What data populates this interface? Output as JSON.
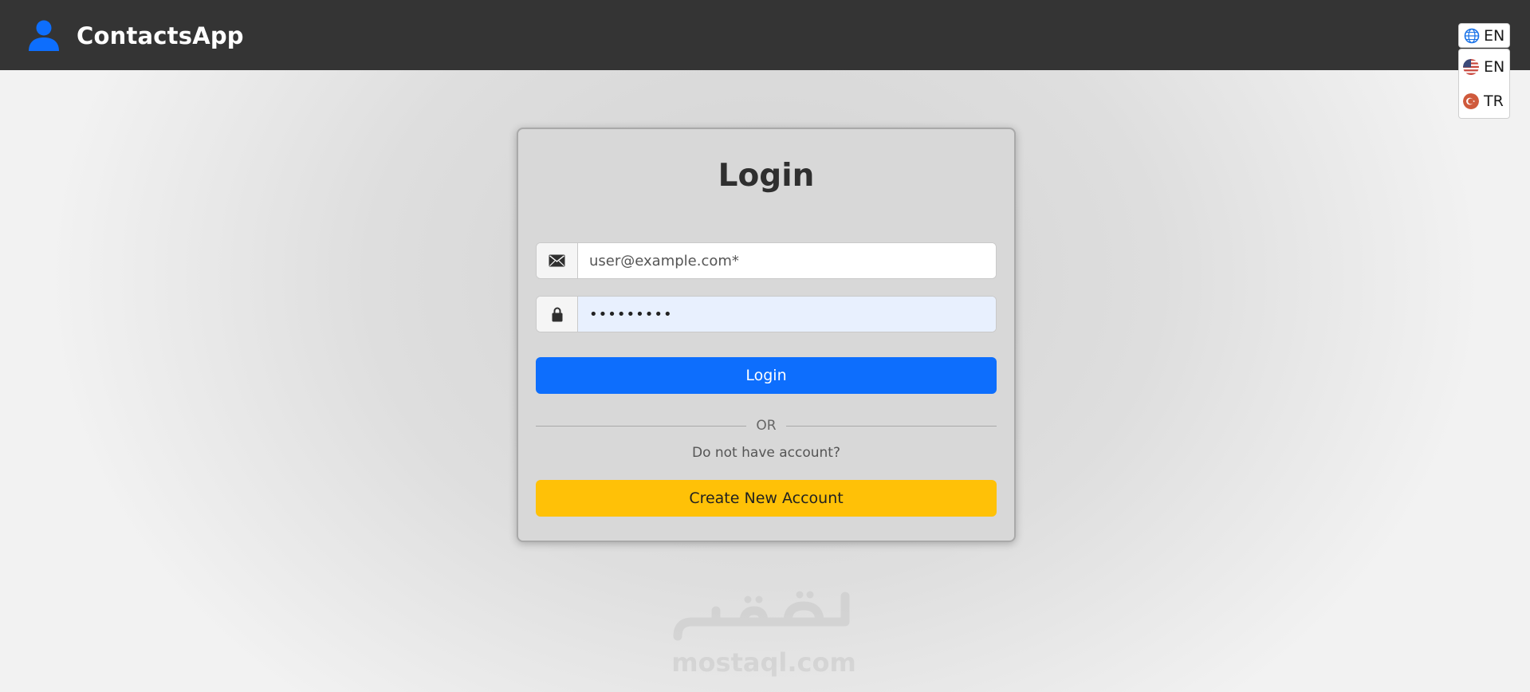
{
  "navbar": {
    "brand": "ContactsApp",
    "brand_icon": "user-icon",
    "brand_icon_color": "#0d6efd",
    "background": "#343434"
  },
  "language": {
    "current": "EN",
    "current_icon": "globe-icon",
    "options": [
      {
        "label": "EN",
        "icon": "us-flag-icon"
      },
      {
        "label": "TR",
        "icon": "tr-flag-icon"
      }
    ]
  },
  "login": {
    "title": "Login",
    "email_placeholder": "user@example.com*",
    "email_icon": "envelope-icon",
    "password_value": "•••••••••",
    "password_icon": "lock-icon",
    "login_button": "Login",
    "divider_text": "OR",
    "no_account_text": "Do not have account?",
    "create_button": "Create New Account"
  },
  "colors": {
    "primary": "#0d6efd",
    "warning": "#ffc107",
    "autofill": "#e8f0fe"
  },
  "watermark": {
    "text": "mostaql.com"
  }
}
